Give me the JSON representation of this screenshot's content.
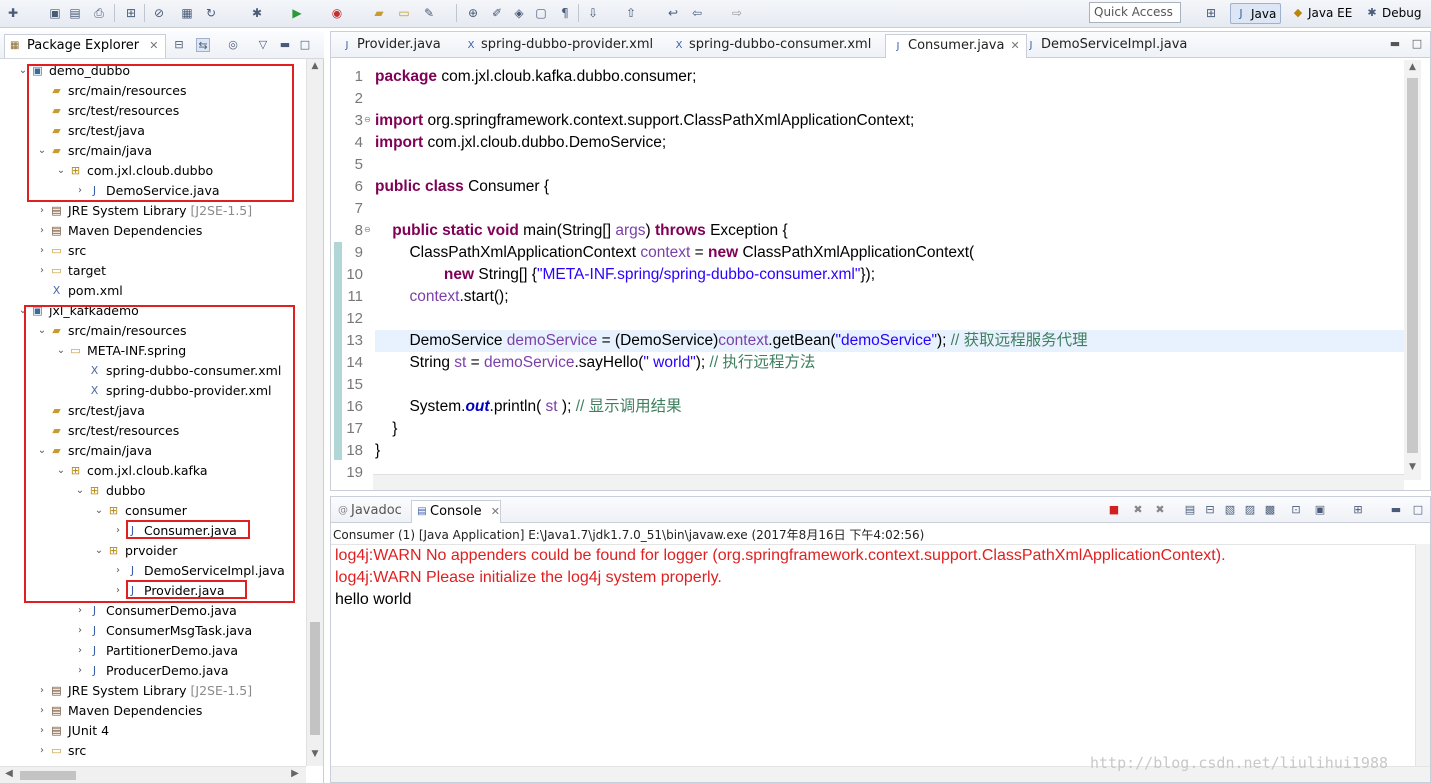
{
  "toolbar": {
    "quick_access_placeholder": "Quick Access",
    "perspectives": [
      {
        "label": "Java",
        "active": true
      },
      {
        "label": "Java EE",
        "active": false
      },
      {
        "label": "Debug",
        "active": false
      }
    ]
  },
  "package_explorer": {
    "title": "Package Explorer",
    "tree": [
      {
        "label": "demo_dubbo",
        "depth": 0,
        "twisty": "open",
        "icon": "project-icon"
      },
      {
        "label": "src/main/resources",
        "depth": 1,
        "twisty": "",
        "icon": "source-folder-icon"
      },
      {
        "label": "src/test/resources",
        "depth": 1,
        "twisty": "",
        "icon": "source-folder-icon"
      },
      {
        "label": "src/test/java",
        "depth": 1,
        "twisty": "",
        "icon": "source-folder-icon"
      },
      {
        "label": "src/main/java",
        "depth": 1,
        "twisty": "open",
        "icon": "source-folder-icon"
      },
      {
        "label": "com.jxl.cloub.dubbo",
        "depth": 2,
        "twisty": "open",
        "icon": "package-icon"
      },
      {
        "label": "DemoService.java",
        "depth": 3,
        "twisty": "closed",
        "icon": "java-file-icon"
      },
      {
        "label": "JRE System Library",
        "decor": "[J2SE-1.5]",
        "depth": 1,
        "twisty": "closed",
        "icon": "library-icon"
      },
      {
        "label": "Maven Dependencies",
        "depth": 1,
        "twisty": "closed",
        "icon": "library-icon"
      },
      {
        "label": "src",
        "depth": 1,
        "twisty": "closed",
        "icon": "folder-icon"
      },
      {
        "label": "target",
        "depth": 1,
        "twisty": "closed",
        "icon": "folder-icon"
      },
      {
        "label": "pom.xml",
        "depth": 1,
        "twisty": "",
        "icon": "xml-file-icon"
      },
      {
        "label": "jxl_kafkademo",
        "depth": 0,
        "twisty": "open",
        "icon": "project-icon"
      },
      {
        "label": "src/main/resources",
        "depth": 1,
        "twisty": "open",
        "icon": "source-folder-icon"
      },
      {
        "label": "META-INF.spring",
        "depth": 2,
        "twisty": "open",
        "icon": "folder-icon"
      },
      {
        "label": "spring-dubbo-consumer.xml",
        "depth": 3,
        "twisty": "",
        "icon": "xml-file-icon"
      },
      {
        "label": "spring-dubbo-provider.xml",
        "depth": 3,
        "twisty": "",
        "icon": "xml-file-icon"
      },
      {
        "label": "src/test/java",
        "depth": 1,
        "twisty": "",
        "icon": "source-folder-icon"
      },
      {
        "label": "src/test/resources",
        "depth": 1,
        "twisty": "",
        "icon": "source-folder-icon"
      },
      {
        "label": "src/main/java",
        "depth": 1,
        "twisty": "open",
        "icon": "source-folder-icon"
      },
      {
        "label": "com.jxl.cloub.kafka",
        "depth": 2,
        "twisty": "open",
        "icon": "package-icon"
      },
      {
        "label": "dubbo",
        "depth": 3,
        "twisty": "open",
        "icon": "package-icon"
      },
      {
        "label": "consumer",
        "depth": 4,
        "twisty": "open",
        "icon": "package-icon"
      },
      {
        "label": "Consumer.java",
        "depth": 5,
        "twisty": "closed",
        "icon": "java-file-icon"
      },
      {
        "label": "prvoider",
        "depth": 4,
        "twisty": "open",
        "icon": "package-icon"
      },
      {
        "label": "DemoServiceImpl.java",
        "depth": 5,
        "twisty": "closed",
        "icon": "java-file-icon"
      },
      {
        "label": "Provider.java",
        "depth": 5,
        "twisty": "closed",
        "icon": "java-file-icon"
      },
      {
        "label": "ConsumerDemo.java",
        "depth": 3,
        "twisty": "closed",
        "icon": "java-file-icon"
      },
      {
        "label": "ConsumerMsgTask.java",
        "depth": 3,
        "twisty": "closed",
        "icon": "java-file-icon"
      },
      {
        "label": "PartitionerDemo.java",
        "depth": 3,
        "twisty": "closed",
        "icon": "java-file-icon"
      },
      {
        "label": "ProducerDemo.java",
        "depth": 3,
        "twisty": "closed",
        "icon": "java-file-icon"
      },
      {
        "label": "JRE System Library",
        "decor": "[J2SE-1.5]",
        "depth": 1,
        "twisty": "closed",
        "icon": "library-icon"
      },
      {
        "label": "Maven Dependencies",
        "depth": 1,
        "twisty": "closed",
        "icon": "library-icon"
      },
      {
        "label": "JUnit 4",
        "depth": 1,
        "twisty": "closed",
        "icon": "library-icon"
      },
      {
        "label": "src",
        "depth": 1,
        "twisty": "closed",
        "icon": "folder-icon"
      }
    ]
  },
  "editor": {
    "tabs": [
      {
        "label": "Provider.java",
        "icon": "java-file-icon",
        "active": false
      },
      {
        "label": "spring-dubbo-provider.xml",
        "icon": "xml-file-icon",
        "active": false
      },
      {
        "label": "spring-dubbo-consumer.xml",
        "icon": "xml-file-icon",
        "active": false
      },
      {
        "label": "Consumer.java",
        "icon": "java-file-icon",
        "active": true
      },
      {
        "label": "DemoServiceImpl.java",
        "icon": "java-file-icon",
        "active": false
      }
    ],
    "lines": [
      {
        "n": "1",
        "tokens": [
          [
            "kw",
            "package"
          ],
          [
            "",
            "com.jxl.cloub.kafka.dubbo.consumer;"
          ]
        ]
      },
      {
        "n": "2",
        "tokens": []
      },
      {
        "n": "3",
        "fold": true,
        "tokens": [
          [
            "kw",
            "import"
          ],
          [
            "",
            "org.springframework.context.support.ClassPathXmlApplicationContext;"
          ]
        ]
      },
      {
        "n": "4",
        "tokens": [
          [
            "kw",
            "import"
          ],
          [
            "",
            "com.jxl.cloub.dubbo.DemoService;"
          ]
        ]
      },
      {
        "n": "5",
        "tokens": []
      },
      {
        "n": "6",
        "tokens": [
          [
            "kw",
            "public"
          ],
          [
            "kw",
            "class"
          ],
          [
            "",
            "Consumer {"
          ]
        ]
      },
      {
        "n": "7",
        "tokens": []
      },
      {
        "n": "8",
        "fold": true,
        "tokens": [
          [
            "",
            "    "
          ],
          [
            "kw",
            "public static void"
          ],
          [
            "",
            "main(String[] "
          ],
          [
            "fld",
            "args"
          ],
          [
            "",
            ") "
          ],
          [
            "kw",
            "throws"
          ],
          [
            "",
            "Exception {"
          ]
        ]
      },
      {
        "n": "9",
        "tokens": [
          [
            "",
            "        ClassPathXmlApplicationContext "
          ],
          [
            "fld",
            "context"
          ],
          [
            "",
            " = "
          ],
          [
            "kw",
            "new"
          ],
          [
            "",
            "ClassPathXmlApplicationContext("
          ]
        ]
      },
      {
        "n": "10",
        "tokens": [
          [
            "",
            "                "
          ],
          [
            "kw",
            "new"
          ],
          [
            "",
            "String[] {"
          ],
          [
            "str",
            "\"META-INF.spring/spring-dubbo-consumer.xml\""
          ],
          [
            "",
            "});"
          ]
        ]
      },
      {
        "n": "11",
        "tokens": [
          [
            "",
            "        "
          ],
          [
            "fld",
            "context"
          ],
          [
            "",
            ".start();"
          ]
        ]
      },
      {
        "n": "12",
        "tokens": []
      },
      {
        "n": "13",
        "hl": true,
        "tokens": [
          [
            "",
            "        DemoService "
          ],
          [
            "fld",
            "demoService"
          ],
          [
            "",
            " = (DemoService)"
          ],
          [
            "fld",
            "context"
          ],
          [
            "",
            ".getBean("
          ],
          [
            "str",
            "\"demoService\""
          ],
          [
            "",
            "); "
          ],
          [
            "cm",
            "// 获取远程服务代理"
          ]
        ]
      },
      {
        "n": "14",
        "tokens": [
          [
            "",
            "        String "
          ],
          [
            "fld",
            "st"
          ],
          [
            "",
            " = "
          ],
          [
            "fld",
            "demoService"
          ],
          [
            "",
            ".sayHello("
          ],
          [
            "str",
            "\" world\""
          ],
          [
            "",
            "); "
          ],
          [
            "cm",
            "// 执行远程方法"
          ]
        ]
      },
      {
        "n": "15",
        "tokens": []
      },
      {
        "n": "16",
        "tokens": [
          [
            "",
            "        System."
          ],
          [
            "static",
            "out"
          ],
          [
            "",
            ".println( "
          ],
          [
            "fld",
            "st"
          ],
          [
            "",
            " ); "
          ],
          [
            "cm",
            "// 显示调用结果"
          ]
        ]
      },
      {
        "n": "17",
        "tokens": [
          [
            "",
            "    }"
          ]
        ]
      },
      {
        "n": "18",
        "tokens": [
          [
            "",
            "}"
          ]
        ]
      },
      {
        "n": "19",
        "tokens": []
      }
    ]
  },
  "console": {
    "tabs": [
      {
        "label": "Javadoc",
        "icon": "javadoc-icon",
        "active": false
      },
      {
        "label": "Console",
        "icon": "console-icon",
        "active": true
      }
    ],
    "description": "Consumer (1) [Java Application] E:\\Java1.7\\jdk1.7.0_51\\bin\\javaw.exe (2017年8月16日 下午4:02:56)",
    "output": [
      {
        "text": "log4j:WARN No appenders could be found for logger (org.springframework.context.support.ClassPathXmlApplicationContext).",
        "kind": "err"
      },
      {
        "text": "log4j:WARN Please initialize the log4j system properly.",
        "kind": "err"
      },
      {
        "text": "hello world",
        "kind": "out"
      }
    ]
  },
  "watermark": "http://blog.csdn.net/liulihui1988"
}
